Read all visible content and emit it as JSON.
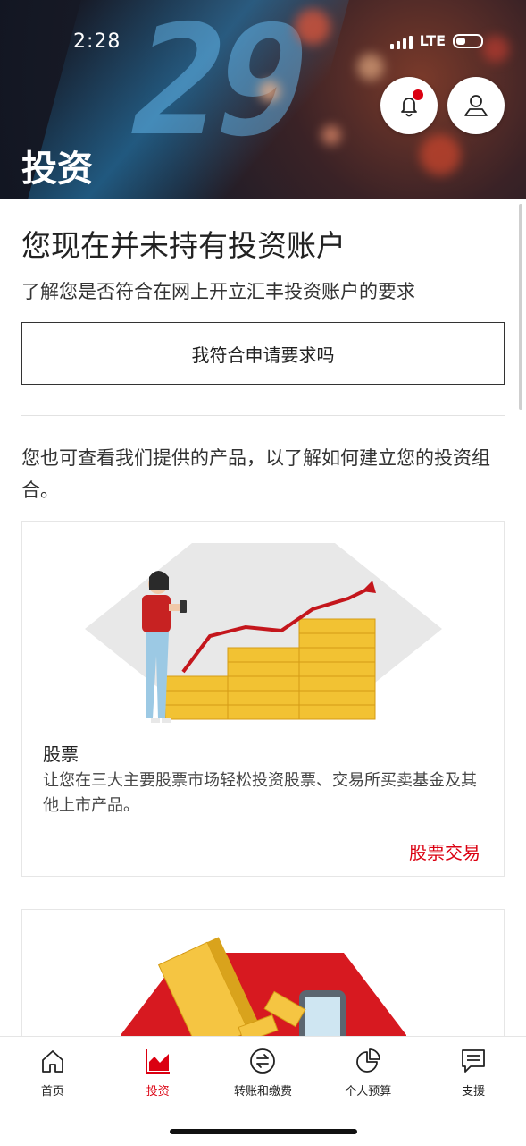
{
  "status_bar": {
    "time": "2:28",
    "network": "LTE"
  },
  "header": {
    "title": "投资",
    "notification_icon": "bell-icon",
    "profile_icon": "user-icon",
    "accent_color": "#db0011"
  },
  "main": {
    "no_account_title": "您现在并未持有投资账户",
    "no_account_subtitle": "了解您是否符合在网上开立汇丰投资账户的要求",
    "eligibility_button": "我符合申请要求吗",
    "intro_text": "您也可查看我们提供的产品，以了解如何建立您的投资组合。",
    "cards": [
      {
        "title": "股票",
        "description": "让您在三大主要股票市场轻松投资股票、交易所买卖基金及其他上市产品。",
        "link": "股票交易"
      },
      {
        "illustration": "gold-bars-phone-illustration"
      }
    ]
  },
  "bottom_nav": {
    "items": [
      {
        "label": "首页",
        "icon": "home-icon",
        "active": false
      },
      {
        "label": "投资",
        "icon": "investment-chart-icon",
        "active": true
      },
      {
        "label": "转账和缴费",
        "icon": "transfer-icon",
        "active": false
      },
      {
        "label": "个人预算",
        "icon": "pie-chart-icon",
        "active": false
      },
      {
        "label": "支援",
        "icon": "chat-support-icon",
        "active": false
      }
    ]
  }
}
